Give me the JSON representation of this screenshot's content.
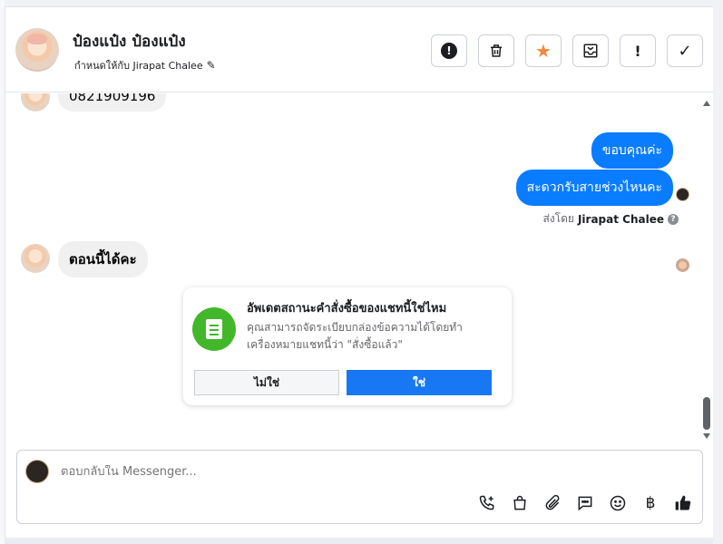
{
  "contact": {
    "name": "ป๋องแป๋ง ป๋องแป๋ง",
    "assign_text": "กำหนดให้กับ Jirapat Chalee"
  },
  "toolbar": {
    "icons": [
      "report-icon",
      "trash-icon",
      "star-icon",
      "mark-unread-icon",
      "important-icon",
      "done-icon"
    ],
    "important_glyph": "!",
    "done_glyph": "✓"
  },
  "messages": {
    "incoming_phone": "0821909196",
    "outgoing": [
      "ขอบคุณค่ะ",
      "สะดวกรับสายช่วงไหนคะ"
    ],
    "sent_by_prefix": "ส่งโดย",
    "sent_by_name": "Jirapat Chalee",
    "incoming_latest": "ตอนนี้ได้คะ"
  },
  "order_prompt": {
    "title": "อัพเดตสถานะคำสั่งซื้อของแชทนี้ใช่ไหม",
    "description": "คุณสามารถจัดระเบียบกล่องข้อความได้โดยทำเครื่องหมายแชทนี้ว่า \"สั่งซื้อแล้ว\"",
    "no_label": "ไม่ใช่",
    "yes_label": "ใช่",
    "accent": "#42b72a"
  },
  "composer": {
    "placeholder": "ตอบกลับใน Messenger...",
    "baht_glyph": "฿",
    "icons": [
      "call-add-icon",
      "shopping-bag-icon",
      "attachment-icon",
      "saved-reply-icon",
      "emoji-icon",
      "baht-icon",
      "like-icon"
    ]
  },
  "colors": {
    "brand_blue": "#1877f2",
    "bubble_blue": "#0a7cff",
    "star_orange": "#f0883e"
  }
}
